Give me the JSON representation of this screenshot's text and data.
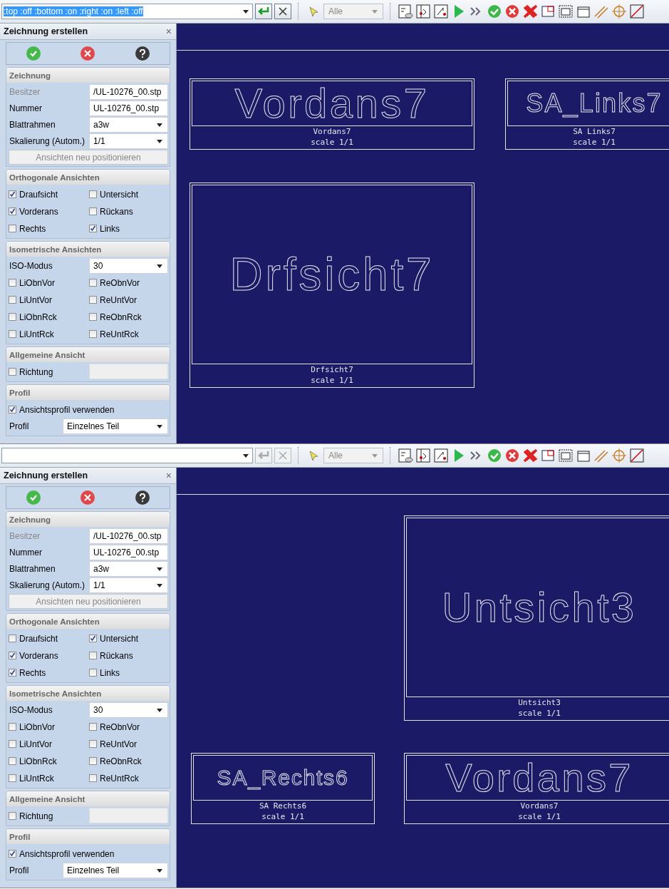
{
  "screens": [
    {
      "command_bar": {
        "value": ":top :off :bottom :on :right :on :left :off",
        "selected": true,
        "disabled": false
      },
      "filter": {
        "value": "Alle"
      },
      "panel": {
        "title": "Zeichnung erstellen",
        "close": "×",
        "sections": [
          {
            "title": "Zeichnung",
            "items": [
              {
                "kind": "readonly",
                "label": "Besitzer",
                "value": "/UL-10276_00.stp"
              },
              {
                "kind": "text",
                "label": "Nummer",
                "value": "UL-10276_00.stp"
              },
              {
                "kind": "select",
                "label": "Blattrahmen",
                "value": "a3w"
              },
              {
                "kind": "select",
                "label": "Skalierung (Autom.)",
                "value": "1/1"
              },
              {
                "kind": "button",
                "label": "Ansichten neu positionieren",
                "disabled": true
              }
            ]
          },
          {
            "title": "Orthogonale Ansichten",
            "items": [
              {
                "kind": "checkbox",
                "label": "Draufsicht",
                "checked": true
              },
              {
                "kind": "checkbox",
                "label": "Untersicht",
                "checked": false
              },
              {
                "kind": "checkbox",
                "label": "Vorderans",
                "checked": true
              },
              {
                "kind": "checkbox",
                "label": "Rückans",
                "checked": false
              },
              {
                "kind": "checkbox",
                "label": "Rechts",
                "checked": false
              },
              {
                "kind": "checkbox",
                "label": "Links",
                "checked": true
              }
            ]
          },
          {
            "title": "Isometrische Ansichten",
            "items": [
              {
                "kind": "select",
                "label": "ISO-Modus",
                "value": "30"
              },
              {
                "kind": "checkbox",
                "label": "LiObnVor",
                "checked": false
              },
              {
                "kind": "checkbox",
                "label": "ReObnVor",
                "checked": false
              },
              {
                "kind": "checkbox",
                "label": "LiUntVor",
                "checked": false
              },
              {
                "kind": "checkbox",
                "label": "ReUntVor",
                "checked": false
              },
              {
                "kind": "checkbox",
                "label": "LiObnRck",
                "checked": false
              },
              {
                "kind": "checkbox",
                "label": "ReObnRck",
                "checked": false
              },
              {
                "kind": "checkbox",
                "label": "LiUntRck",
                "checked": false
              },
              {
                "kind": "checkbox",
                "label": "ReUntRck",
                "checked": false
              }
            ]
          },
          {
            "title": "Allgemeine Ansicht",
            "items": [
              {
                "kind": "checkbox_field",
                "label": "Richtung",
                "checked": false
              }
            ]
          },
          {
            "title": "Profil",
            "items": [
              {
                "kind": "checkbox",
                "label": "Ansichtsprofil verwenden",
                "checked": true
              },
              {
                "kind": "wide_select",
                "label": "Profil",
                "value": "Einzelnes Teil"
              }
            ]
          }
        ]
      },
      "canvas": {
        "views": [
          {
            "kind": "small",
            "label": "Vordans7",
            "caption": "Vordans7",
            "scale": "scale 1/1"
          },
          {
            "kind": "small",
            "label": "SA_Links7",
            "caption": "SA Links7",
            "scale": "scale 1/1"
          },
          {
            "kind": "large",
            "label": "Drfsicht7",
            "caption": "Drfsicht7",
            "scale": "scale 1/1"
          }
        ]
      }
    },
    {
      "command_bar": {
        "disabled": true
      },
      "filter": {
        "value": "Alle"
      },
      "panel": {
        "title": "Zeichnung erstellen",
        "close": "×",
        "sections": [
          {
            "title": "Zeichnung",
            "items": [
              {
                "kind": "readonly",
                "label": "Besitzer",
                "value": "/UL-10276_00.stp"
              },
              {
                "kind": "text",
                "label": "Nummer",
                "value": "UL-10276_00.stp"
              },
              {
                "kind": "select",
                "label": "Blattrahmen",
                "value": "a3w"
              },
              {
                "kind": "select",
                "label": "Skalierung (Autom.)",
                "value": "1/1"
              },
              {
                "kind": "button",
                "label": "Ansichten neu positionieren",
                "disabled": true
              }
            ]
          },
          {
            "title": "Orthogonale Ansichten",
            "items": [
              {
                "kind": "checkbox",
                "label": "Draufsicht",
                "checked": false
              },
              {
                "kind": "checkbox",
                "label": "Untersicht",
                "checked": true
              },
              {
                "kind": "checkbox",
                "label": "Vorderans",
                "checked": true
              },
              {
                "kind": "checkbox",
                "label": "Rückans",
                "checked": false
              },
              {
                "kind": "checkbox",
                "label": "Rechts",
                "checked": true
              },
              {
                "kind": "checkbox",
                "label": "Links",
                "checked": false
              }
            ]
          },
          {
            "title": "Isometrische Ansichten",
            "items": [
              {
                "kind": "select",
                "label": "ISO-Modus",
                "value": "30"
              },
              {
                "kind": "checkbox",
                "label": "LiObnVor",
                "checked": false
              },
              {
                "kind": "checkbox",
                "label": "ReObnVor",
                "checked": false
              },
              {
                "kind": "checkbox",
                "label": "LiUntVor",
                "checked": false
              },
              {
                "kind": "checkbox",
                "label": "ReUntVor",
                "checked": false
              },
              {
                "kind": "checkbox",
                "label": "LiObnRck",
                "checked": false
              },
              {
                "kind": "checkbox",
                "label": "ReObnRck",
                "checked": false
              },
              {
                "kind": "checkbox",
                "label": "LiUntRck",
                "checked": false
              },
              {
                "kind": "checkbox",
                "label": "ReUntRck",
                "checked": false
              }
            ]
          },
          {
            "title": "Allgemeine Ansicht",
            "items": [
              {
                "kind": "checkbox_field",
                "label": "Richtung",
                "checked": false
              }
            ]
          },
          {
            "title": "Profil",
            "items": [
              {
                "kind": "checkbox",
                "label": "Ansichtsprofil verwenden",
                "checked": true
              },
              {
                "kind": "wide_select",
                "label": "Profil",
                "value": "Einzelnes Teil"
              }
            ]
          }
        ]
      },
      "canvas": {
        "views": [
          {
            "kind": "large",
            "label": "Untsicht3",
            "caption": "Untsicht3",
            "scale": "scale 1/1"
          },
          {
            "kind": "small",
            "label": "SA_Rechts6",
            "caption": "SA Rechts6",
            "scale": "scale 1/1"
          },
          {
            "kind": "small",
            "label": "Vordans7",
            "caption": "Vordans7",
            "scale": "scale 1/1"
          }
        ]
      }
    }
  ]
}
